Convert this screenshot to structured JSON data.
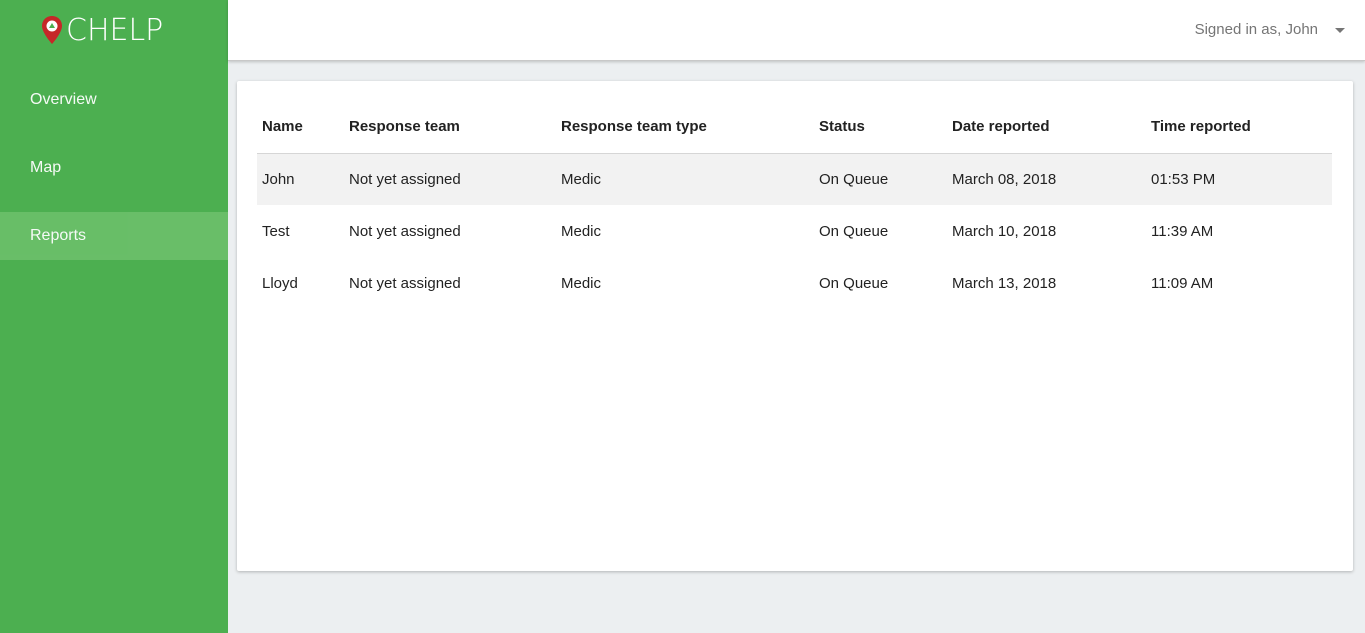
{
  "app": {
    "title": "CHELP"
  },
  "colors": {
    "sidebar": "#4caf50",
    "active_item": "#6abf69",
    "logo_pin": "#c62828"
  },
  "sidebar": {
    "items": [
      {
        "label": "Overview"
      },
      {
        "label": "Map"
      },
      {
        "label": "Reports"
      }
    ],
    "active": "Reports"
  },
  "header": {
    "user_label": "Signed in as, John"
  },
  "table": {
    "columns": [
      "Name",
      "Response team",
      "Response team type",
      "Status",
      "Date reported",
      "Time reported"
    ],
    "rows": [
      [
        "John",
        "Not yet assigned",
        "Medic",
        "On Queue",
        "March 08, 2018",
        "01:53 PM"
      ],
      [
        "Test",
        "Not yet assigned",
        "Medic",
        "On Queue",
        "March 10, 2018",
        "11:39 AM"
      ],
      [
        "Lloyd",
        "Not yet assigned",
        "Medic",
        "On Queue",
        "March 13, 2018",
        "11:09 AM"
      ]
    ]
  }
}
